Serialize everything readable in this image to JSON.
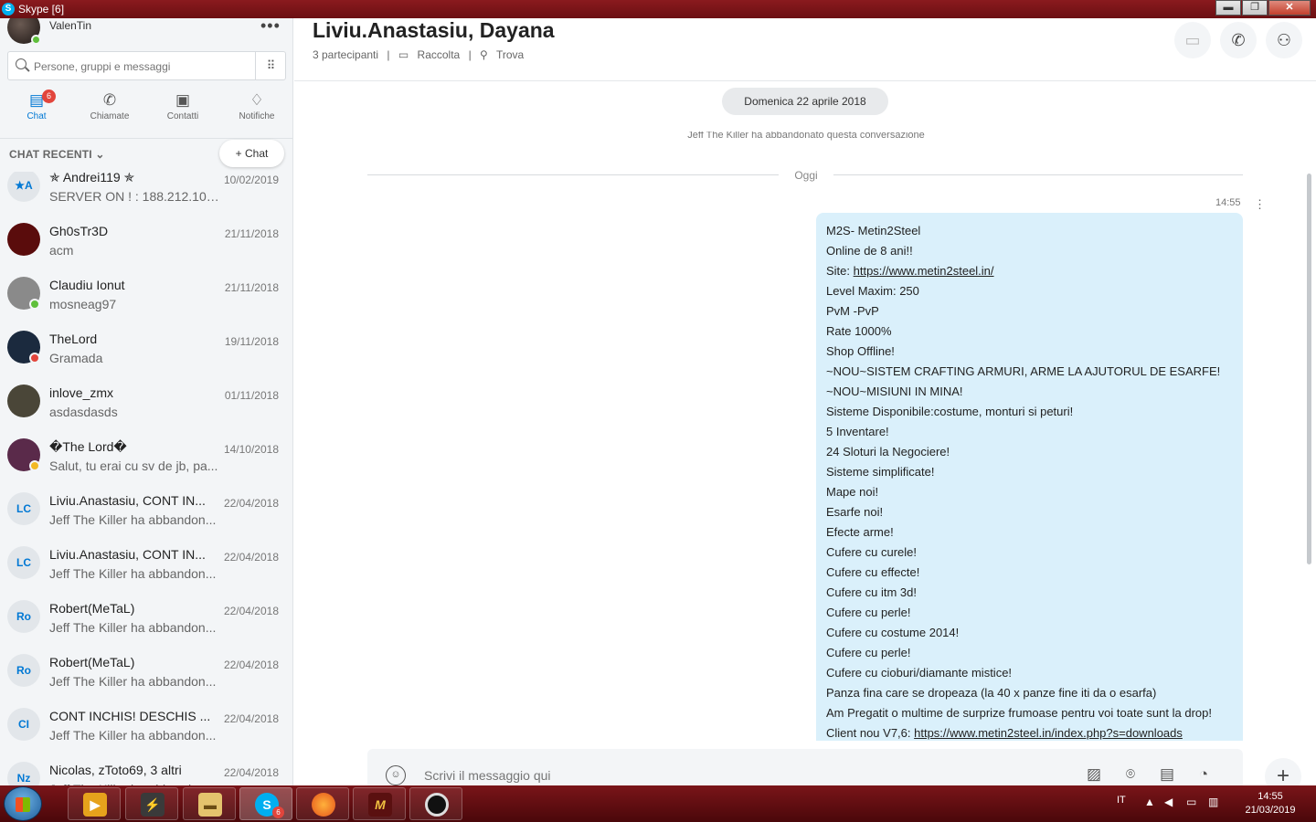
{
  "window": {
    "title": "Skype [6]",
    "logo": "S",
    "minimize": "▬",
    "maximize": "❐",
    "close": "✕"
  },
  "sidebar": {
    "user": {
      "name": "ValenTin"
    },
    "more": "•••",
    "search": {
      "placeholder": "Persone, gruppi e messaggi"
    },
    "nav": [
      {
        "label": "Chat",
        "badge": "6",
        "icon": "chat-icon",
        "active": true
      },
      {
        "label": "Chiamate",
        "icon": "phone-icon"
      },
      {
        "label": "Contatti",
        "icon": "contacts-icon"
      },
      {
        "label": "Notifiche",
        "icon": "bell-icon"
      }
    ],
    "recent_label": "CHAT RECENTI",
    "new_chat_label": "Chat",
    "chats": [
      {
        "initials": "★A",
        "name": "✯ Andrei119 ✯",
        "preview": "SERVER ON ! : 188.212.100....",
        "date": "10/02/2019"
      },
      {
        "initials": "",
        "name": "Gh0sTr3D",
        "preview": "acm",
        "date": "21/11/2018",
        "avatar_color": "#5a0c0c"
      },
      {
        "initials": "",
        "name": "Claudiu Ionut",
        "preview": "mosneag97",
        "date": "21/11/2018",
        "avatar_color": "#8a8a8a",
        "status": "#5fbf3b"
      },
      {
        "initials": "",
        "name": "TheLord",
        "preview": "Gramada",
        "date": "19/11/2018",
        "avatar_color": "#1b2a3e",
        "status": "#e2453c"
      },
      {
        "initials": "",
        "name": "inlove_zmx",
        "preview": "asdasdasds",
        "date": "01/11/2018",
        "avatar_color": "#4a4638"
      },
      {
        "initials": "",
        "name": "�The Lord�",
        "preview": "Salut, tu erai cu sv de jb, pa...",
        "date": "14/10/2018",
        "avatar_color": "#5a2a4a",
        "status": "#f2b824"
      },
      {
        "initials": "LC",
        "name": "Liviu.Anastasiu, CONT IN...",
        "preview": "Jeff The Killer ha abbandon...",
        "date": "22/04/2018"
      },
      {
        "initials": "LC",
        "name": "Liviu.Anastasiu, CONT IN...",
        "preview": "Jeff The Killer ha abbandon...",
        "date": "22/04/2018"
      },
      {
        "initials": "Ro",
        "name": "Robert(MeTaL)",
        "preview": "Jeff The Killer ha abbandon...",
        "date": "22/04/2018"
      },
      {
        "initials": "Ro",
        "name": "Robert(MeTaL)",
        "preview": "Jeff The Killer ha abbandon...",
        "date": "22/04/2018"
      },
      {
        "initials": "CI",
        "name": "CONT INCHIS! DESCHIS ...",
        "preview": "Jeff The Killer ha abbandon...",
        "date": "22/04/2018"
      },
      {
        "initials": "Nz",
        "name": "Nicolas, zToto69, 3 altri",
        "preview": "Jeff The Killer ha abbandon...",
        "date": "22/04/2018"
      }
    ]
  },
  "conversation": {
    "title": "Liviu.Anastasiu, Dayana",
    "participants": "3 partecipanti",
    "gallery": "Raccolta",
    "find": "Trova",
    "separator": "|",
    "date_pill": "Domenica 22 aprile 2018",
    "left_notice": "Jeff The Killer ha abbandonato questa conversazione",
    "today": "Oggi",
    "message_time": "14:55",
    "message_lines": [
      "M2S- Metin2Steel",
      "Online de 8 ani!!",
      "Level Maxim: 250",
      "PvM -PvP",
      "Rate 1000%",
      "Shop Offline!",
      "~NOU~SISTEM CRAFTING ARMURI, ARME LA AJUTORUL DE ESARFE!",
      "~NOU~MISIUNI IN MINA!",
      "Sisteme Disponibile:costume, monturi si peturi!",
      "5 Inventare!",
      "24 Sloturi la Negociere!",
      "Sisteme simplificate!",
      "Mape noi!",
      "Esarfe noi!",
      "Efecte arme!",
      "Cufere cu curele!",
      "Cufere cu effecte!",
      "Cufere cu itm 3d!",
      "Cufere cu perle!",
      "Cufere cu costume 2014!",
      "Cufere cu perle!",
      "Cufere cu cioburi/diamante mistice!",
      "Panza fina care se dropeaza (la 40 x panze fine iti da o esarfa)",
      "Am Pregatit o multime de surprize frumoase pentru voi toate sunt la drop!"
    ],
    "site_prefix": "Site: ",
    "site_link": "https://www.metin2steel.in/",
    "client_prefix": "Client nou V7,6: ",
    "client_link": "https://www.metin2steel.in/index.php?s=downloads",
    "composer_placeholder": "Scrivi il messaggio qui"
  },
  "taskbar": {
    "lang": "IT",
    "time": "14:55",
    "date": "21/03/2019",
    "skype_badge": "6"
  }
}
